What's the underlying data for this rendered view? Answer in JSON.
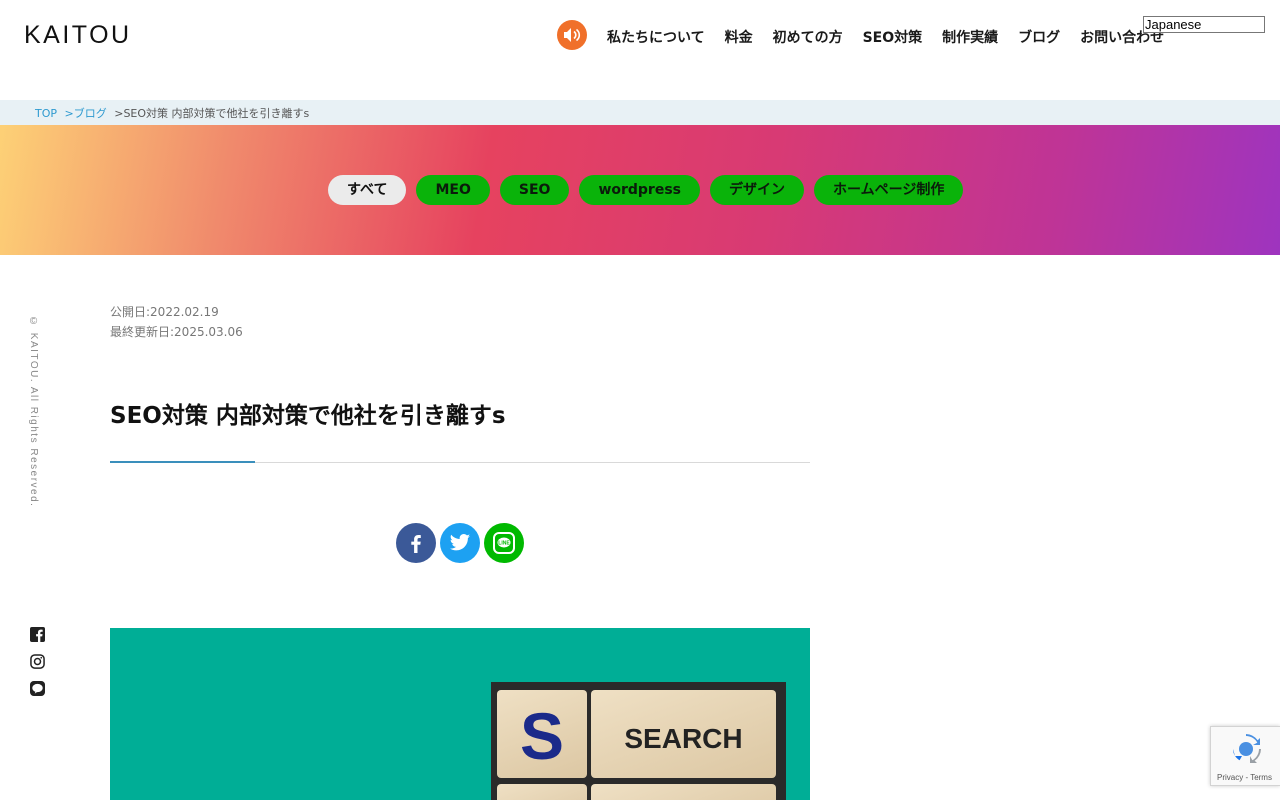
{
  "header": {
    "logo": "KAITOU",
    "nav": [
      "私たちについて",
      "料金",
      "初めての方",
      "SEO対策",
      "制作実績",
      "ブログ",
      "お問い合わせ"
    ],
    "language": "Japanese",
    "sound_icon": "speaker-icon",
    "accent_color": "#f0702a"
  },
  "breadcrumb": {
    "items": [
      "TOP",
      ">ブログ",
      ">SEO対策 内部対策で他社を引き離すs"
    ]
  },
  "categories": {
    "items": [
      "すべて",
      "MEO",
      "SEO",
      "wordpress",
      "デザイン",
      "ホームページ制作"
    ],
    "active": "すべて",
    "button_color": "#0ab30a"
  },
  "sidebar": {
    "copyright": "© KAITOU. All Rights Reserved.",
    "social_icons": [
      "facebook-icon",
      "instagram-icon",
      "line-icon"
    ]
  },
  "article": {
    "published": "公開日:2022.02.19",
    "updated": "最終更新日:2025.03.06",
    "title": "SEO対策 内部対策で他社を引き離すs",
    "share_buttons": [
      "facebook-icon",
      "twitter-icon",
      "line-icon"
    ],
    "eyecatch": {
      "background": "#00ae96",
      "tile_letter": "S",
      "tile_word": "SEARCH"
    }
  },
  "recaptcha": {
    "footer": "Privacy - Terms"
  }
}
